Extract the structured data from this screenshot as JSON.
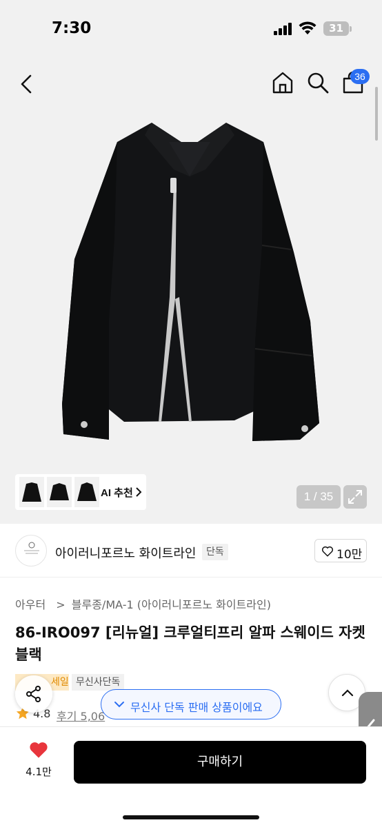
{
  "status_bar": {
    "time": "7:30",
    "battery": "31"
  },
  "nav": {
    "cart_badge": "36"
  },
  "gallery": {
    "ai_recommend_label": "AI 추천",
    "counter": "1 / 35",
    "thumbnail_count": 3
  },
  "brand": {
    "name": "아이러니포르노 화이트라인",
    "tag": "단독",
    "like_count": "10만"
  },
  "breadcrumb": {
    "category": "아우터",
    "separator": ">",
    "subcategory": "블루종/MA-1 (아이러니포르노 화이트라인)"
  },
  "product": {
    "title": "86-IRO097 [리뉴얼] 크루얼티프리 알파 스웨이드 자켓 블랙",
    "sale_tag": "세일",
    "exclusive_tag": "무신사단독",
    "rating": "4.8",
    "review_label": "후기 5,06"
  },
  "banner": {
    "text": "무신사 단독 판매 상품이에요"
  },
  "bottom_bar": {
    "like_count": "4.1만",
    "buy_label": "구매하기"
  },
  "colors": {
    "accent_blue": "#2b6ef2",
    "heart_red": "#e8353c",
    "star_orange": "#f5a623",
    "sale_bg": "#fde9c4"
  }
}
